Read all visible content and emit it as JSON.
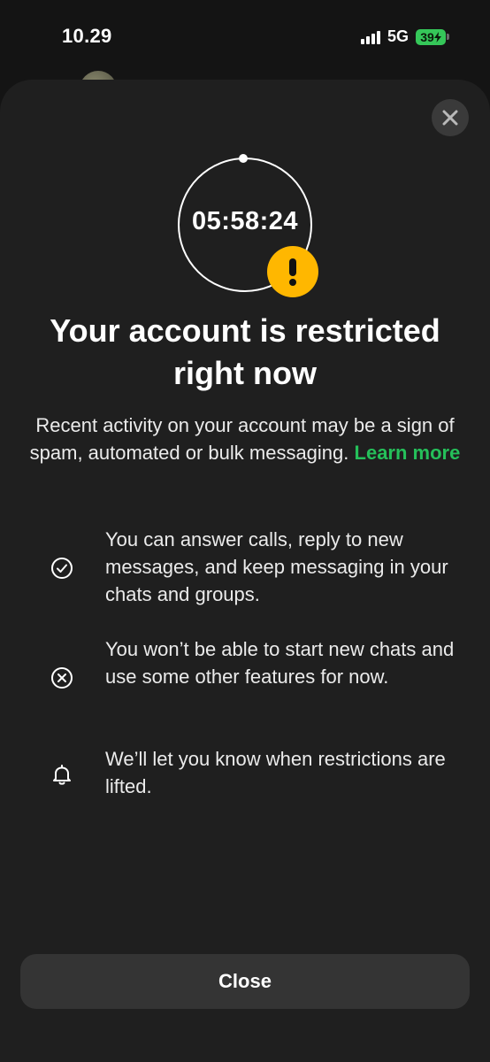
{
  "status_bar": {
    "time": "10.29",
    "network": "5G",
    "battery": "39"
  },
  "sheet": {
    "timer": "05:58:24",
    "title": "Your account is restricted right now",
    "description": "Recent activity on your account may be a sign of spam, automated or bulk messaging.",
    "learn_more": "Learn more",
    "items": [
      {
        "icon": "check-circle-icon",
        "text": "You can answer calls, reply to new messages, and keep messaging in your chats and groups."
      },
      {
        "icon": "x-circle-icon",
        "text": "You won’t be able to start new chats and use some other features for now."
      },
      {
        "icon": "bell-icon",
        "text": "We’ll let you know when restrictions are lifted."
      }
    ],
    "close_button": "Close"
  },
  "colors": {
    "accent_link": "#25c05a",
    "warning": "#ffb700",
    "battery": "#35c759",
    "sheet_background": "#1f1f1f"
  }
}
